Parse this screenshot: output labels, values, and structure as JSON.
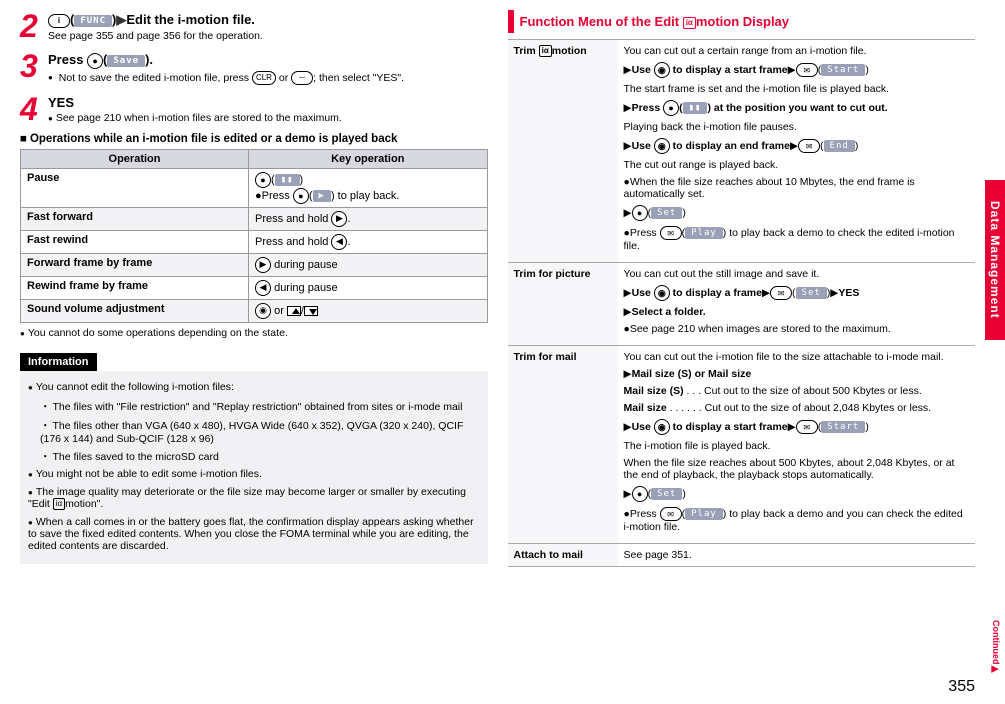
{
  "sideTab": "Data Management",
  "pageNumber": "355",
  "continued": "Continued",
  "left": {
    "step2": {
      "titlePrefix": "i",
      "softlabel": "FUNC",
      "titleSuffix": "Edit the i-motion file.",
      "note": "See page 355 and page 356 for the operation."
    },
    "step3": {
      "title": "Press ",
      "softlabel": "Save",
      "titleSuffix": ".",
      "bullet": "Not to save the edited i-motion file, press ",
      "bulletMid": " or ",
      "bulletEnd": "; then select \"YES\"."
    },
    "step4": {
      "title": "YES",
      "bullet": "See page 210 when i-motion files are stored to the maximum."
    },
    "opsTitle": "Operations while an i-motion file is edited or a demo is played back",
    "table": {
      "headers": [
        "Operation",
        "Key operation"
      ],
      "rows": [
        {
          "op": "Pause",
          "key1": "(",
          "keyPauseLabel": "▮▮",
          "key1end": ")",
          "key2pre": "Press ",
          "key2label": "▶",
          "key2end": ") to play back."
        },
        {
          "op": "Fast forward",
          "key": "Press and hold "
        },
        {
          "op": "Fast rewind",
          "key": "Press and hold "
        },
        {
          "op": "Forward frame by frame",
          "key": " during pause"
        },
        {
          "op": "Rewind frame by frame",
          "key": " during pause"
        },
        {
          "op": "Sound volume adjustment",
          "key": " or "
        }
      ]
    },
    "underTable": "You cannot do some operations depending on the state.",
    "info": {
      "header": "Information",
      "b1": "You cannot edit the following i-motion files:",
      "s1": "The files with \"File restriction\" and \"Replay restriction\" obtained from sites or i-mode mail",
      "s2": "The files other than VGA (640 x 480), HVGA Wide (640 x 352), QVGA (320 x 240), QCIF (176 x 144) and Sub-QCIF (128 x 96)",
      "s3": "The files saved to the microSD card",
      "b2": "You might not be able to edit some i-motion files.",
      "b3": "The image quality may deteriorate or the file size may become larger or smaller by executing \"Edit 〓motion\".",
      "b4": "When a call comes in or the battery goes flat, the confirmation display appears asking whether to save the fixed edited contents. When you close the FOMA terminal while you are editing, the edited contents are discarded."
    }
  },
  "right": {
    "header": "Function Menu of the Edit 〓motion Display",
    "rows": {
      "trimMotion": {
        "name": "Trim 〓motion",
        "l1": "You can cut out a certain range from an i-motion file.",
        "l2a": "Use ",
        "l2b": " to display a start frame",
        "l2soft": "Start",
        "l3": "The start frame is set and the i-motion file is played back.",
        "l4a": "Press ",
        "l4soft": "▮▮",
        "l4b": ") at the position you want to cut out.",
        "l5": "Playing back the i-motion file pauses.",
        "l6a": "Use ",
        "l6b": " to display an end frame",
        "l6soft": "End",
        "l7": "The cut out range is played back.",
        "l8": "When the file size reaches about 10 Mbytes, the end frame is automatically set.",
        "l9soft": "Set",
        "l10a": "Press ",
        "l10soft": "Play",
        "l10b": ") to play back a demo to check the edited i-motion file."
      },
      "trimPicture": {
        "name": "Trim for picture",
        "l1": "You can cut out the still image and save it.",
        "l2a": "Use ",
        "l2b": " to display a frame",
        "l2soft": "Set",
        "l2yes": "YES",
        "l3": "Select a folder.",
        "l4": "See page 210 when images are stored to the maximum."
      },
      "trimMail": {
        "name": "Trim for mail",
        "l1": "You can cut out the i-motion file to the size attachable to i-mode mail.",
        "l2": "Mail size (S) or Mail size",
        "l3a": "Mail size (S)",
        "l3b": " . . . Cut out to the size of about 500 Kbytes or less.",
        "l4a": "Mail size",
        "l4b": " . . . . . . Cut out to the size of about 2,048 Kbytes or less.",
        "l5a": "Use ",
        "l5b": " to display a start frame",
        "l5soft": "Start",
        "l6": "The i-motion file is played back.",
        "l7": "When the file size reaches about 500 Kbytes, about 2,048 Kbytes, or at the end of playback, the playback stops automatically.",
        "l8soft": "Set",
        "l9a": "Press ",
        "l9soft": "Play",
        "l9b": ") to play back a demo and you can check the edited i-motion file."
      },
      "attach": {
        "name": "Attach to mail",
        "l1": "See page 351."
      }
    }
  }
}
